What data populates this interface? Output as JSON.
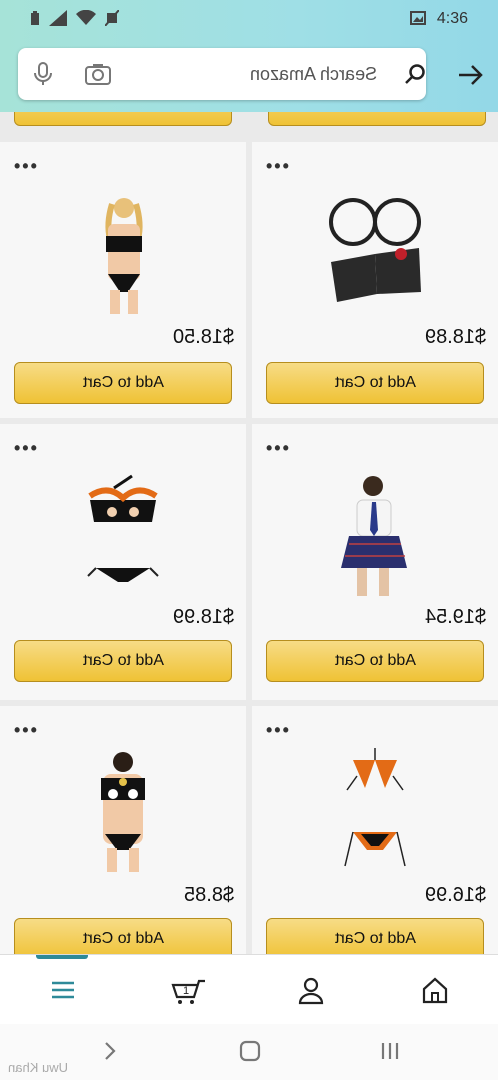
{
  "status_bar": {
    "time": "4:36"
  },
  "search": {
    "placeholder": "Search Amazon"
  },
  "products": [
    {
      "price": "$18.50",
      "button": "Add to Cart",
      "image": "lingerie-model-black"
    },
    {
      "price": "$18.89",
      "button": "Add to Cart",
      "image": "puzzle-keychain"
    },
    {
      "price": "$18.99",
      "button": "Add to Cart",
      "image": "black-orange-lingerie-set"
    },
    {
      "price": "$19.54",
      "button": "Add to Cart",
      "image": "schoolgirl-costume"
    },
    {
      "price": "$8.85",
      "button": "Add to Cart",
      "image": "black-bell-lingerie"
    },
    {
      "price": "$16.99",
      "button": "Add to Cart",
      "image": "orange-bikini-set"
    }
  ],
  "bottom_nav": {
    "items": [
      "menu",
      "cart",
      "account",
      "home"
    ]
  },
  "watermark": "Uwu Khan",
  "colors": {
    "header_gradient_start": "#a6e3d8",
    "header_gradient_end": "#93d8e7",
    "button_yellow": "#efc235",
    "accent_teal": "#2e8a99"
  }
}
